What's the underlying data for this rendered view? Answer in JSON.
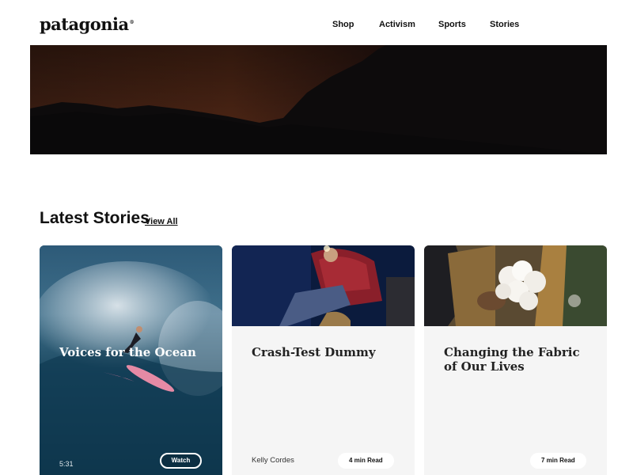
{
  "brand": {
    "logo_text": "patagonia"
  },
  "nav": {
    "items": [
      "Shop",
      "Activism",
      "Sports",
      "Stories"
    ]
  },
  "section": {
    "title": "Latest Stories",
    "view_all": "View All"
  },
  "cards": [
    {
      "title": "Voices for the Ocean",
      "duration": "5:31",
      "action": "Watch"
    },
    {
      "title": "Crash-Test Dummy",
      "author": "Kelly Cordes",
      "read_time": "4 min Read"
    },
    {
      "title": "Changing the Fabric of Our Lives",
      "read_time": "7 min Read"
    }
  ],
  "colors": {
    "card_bg": "#f5f5f5",
    "hero_bg": "#0b0a0b",
    "text": "#111111"
  }
}
